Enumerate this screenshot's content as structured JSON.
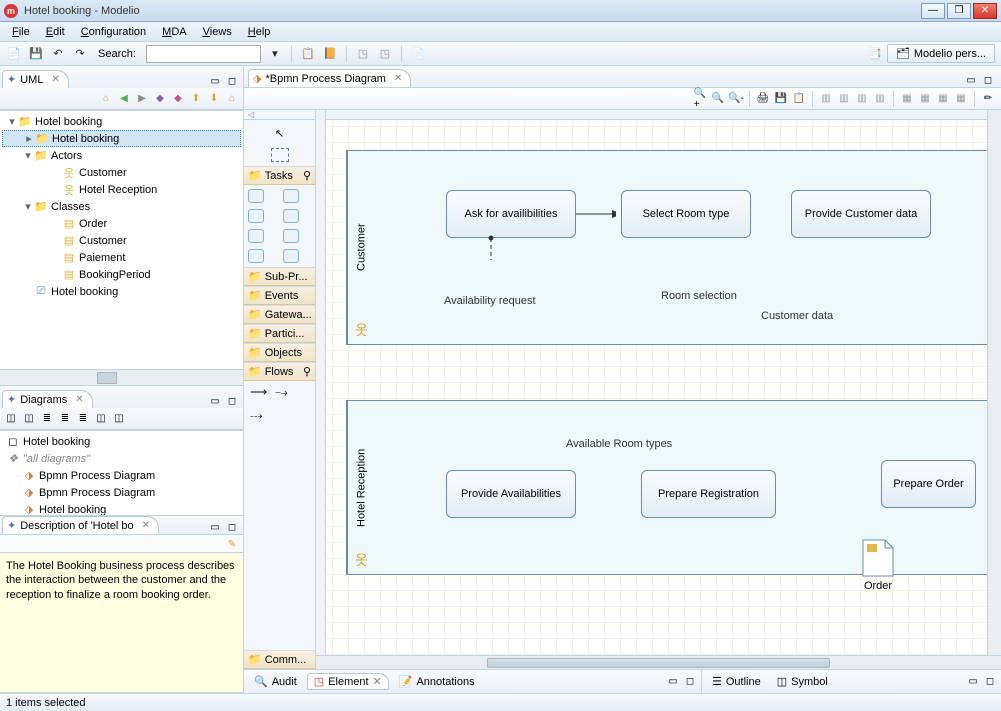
{
  "window": {
    "title": "Hotel booking - Modelio"
  },
  "menu": {
    "file": "File",
    "edit": "Edit",
    "config": "Configuration",
    "mda": "MDA",
    "views": "Views",
    "help": "Help"
  },
  "toolbar": {
    "search_label": "Search:"
  },
  "perspective": {
    "label": "Modelio pers..."
  },
  "views": {
    "uml_tab": "UML",
    "diagrams_tab": "Diagrams",
    "description_tab": "Description of 'Hotel bo"
  },
  "tree": {
    "root": "Hotel booking",
    "pkg": "Hotel booking",
    "actors_folder": "Actors",
    "actor_customer": "Customer",
    "actor_reception": "Hotel Reception",
    "classes_folder": "Classes",
    "cls_order": "Order",
    "cls_customer": "Customer",
    "cls_paiement": "Paiement",
    "cls_bookingperiod": "BookingPeriod",
    "diagram_node": "Hotel booking"
  },
  "diagrams_list": {
    "root": "Hotel booking",
    "all": "\"all diagrams\"",
    "d1": "Bpmn Process Diagram",
    "d2": "Bpmn Process Diagram",
    "d3": "Hotel booking"
  },
  "description": {
    "text": "The Hotel Booking business process describes the interaction between the customer and the reception to finalize a room booking order."
  },
  "editor": {
    "tab_title": "*Bpmn Process Diagram"
  },
  "palette": {
    "tasks": "Tasks",
    "subpr": "Sub-Pr...",
    "events": "Events",
    "gateways": "Gatewa...",
    "participants": "Partici...",
    "objects": "Objects",
    "flows": "Flows",
    "comm": "Comm..."
  },
  "lanes": {
    "customer": "Customer",
    "reception": "Hotel Reception"
  },
  "tasks": {
    "ask": "Ask for availibilities",
    "select": "Select Room type",
    "provide_cust": "Provide Customer data",
    "provide_avail": "Provide Availabilities",
    "prepare_reg": "Prepare Registration",
    "prepare_order": "Prepare Order"
  },
  "data": {
    "order": "Order"
  },
  "messages": {
    "avail_req": "Availability request",
    "room_sel": "Room selection",
    "cust_data": "Customer data",
    "avail_types": "Available Room types"
  },
  "bottom": {
    "audit": "Audit",
    "element": "Element",
    "annotations": "Annotations",
    "outline": "Outline",
    "symbol": "Symbol"
  },
  "status": {
    "text": "1 items selected"
  }
}
